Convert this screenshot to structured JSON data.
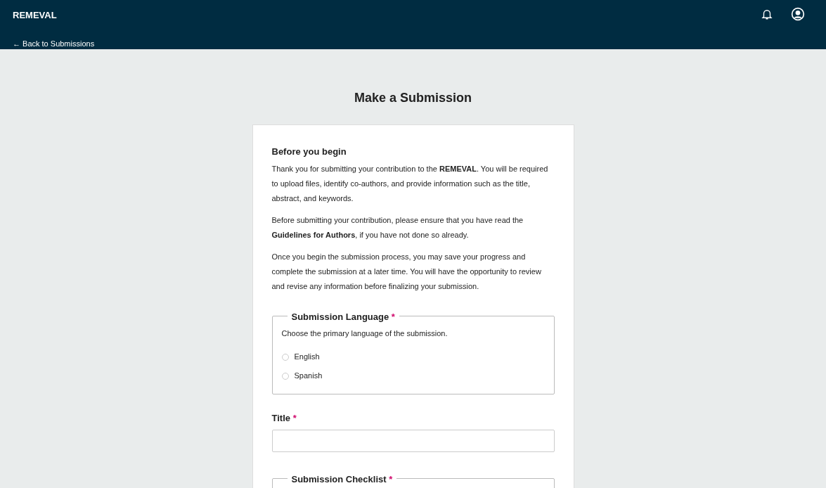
{
  "header": {
    "site_title": "REMEVAL",
    "back_link": "← Back to Submissions"
  },
  "page_title": "Make a Submission",
  "intro": {
    "heading": "Before you begin",
    "paragraphs": [
      "Thank you for submitting your contribution to the **REMEVAL**. You will be required to upload files, identify co-authors, and provide information such as the title, abstract, and keywords.",
      "Before submitting your contribution, please ensure that you have read the **Guidelines for Authors**, if you have not done so already.",
      "Once you begin the submission process, you may save your progress and complete the submission at a later time. You will have the opportunity to review and revise any information before finalizing your submission."
    ]
  },
  "language": {
    "legend": "Submission Language",
    "required_mark": "*",
    "description": "Choose the primary language of the submission.",
    "options": [
      {
        "label": "English",
        "selected": false
      },
      {
        "label": "Spanish",
        "selected": false
      }
    ]
  },
  "title_field": {
    "label": "Title",
    "required_mark": "*"
  },
  "checklist": {
    "legend": "Submission Checklist",
    "required_mark": "*"
  }
}
